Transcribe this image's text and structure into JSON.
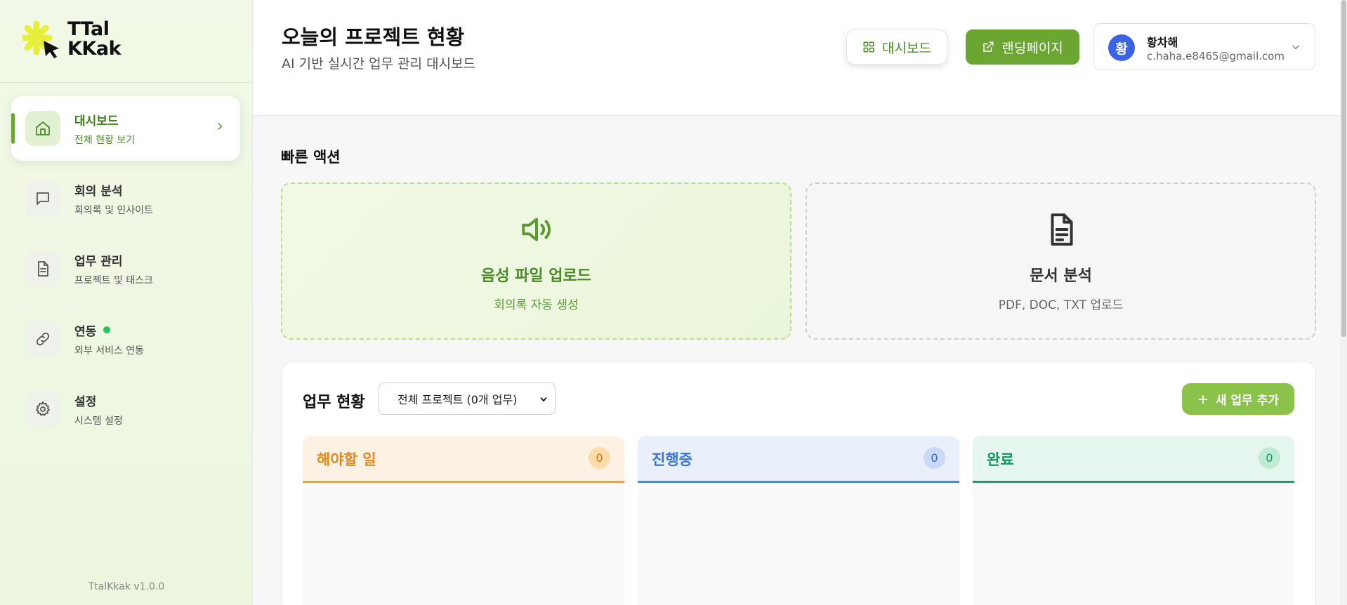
{
  "app": {
    "logo_line1": "TTal",
    "logo_line2": "KKak",
    "version": "TtalKkak v1.0.0"
  },
  "sidebar": {
    "items": [
      {
        "title": "대시보드",
        "subtitle": "전체 현황 보기",
        "icon": "home-icon",
        "active": true
      },
      {
        "title": "회의 분석",
        "subtitle": "회의록 및 인사이트",
        "icon": "message-icon"
      },
      {
        "title": "업무 관리",
        "subtitle": "프로젝트 및 태스크",
        "icon": "document-icon"
      },
      {
        "title": "연동",
        "subtitle": "외부 서비스 연동",
        "icon": "link-icon",
        "status": "connected"
      },
      {
        "title": "설정",
        "subtitle": "시스템 설정",
        "icon": "gear-icon"
      }
    ]
  },
  "header": {
    "title": "오늘의 프로젝트 현황",
    "subtitle": "AI 기반 실시간 업무 관리 대시보드",
    "dashboard_button": "대시보드",
    "landing_button": "랜딩페이지",
    "user": {
      "initial": "황",
      "name": "황차해",
      "email": "c.haha.e8465@gmail.com"
    }
  },
  "quick_actions": {
    "title": "빠른 액션",
    "items": [
      {
        "title": "음성 파일 업로드",
        "subtitle": "회의록 자동 생성",
        "icon": "speaker-icon"
      },
      {
        "title": "문서 분석",
        "subtitle": "PDF, DOC, TXT 업로드",
        "icon": "file-text-icon"
      }
    ]
  },
  "tasks": {
    "title": "업무 현황",
    "project_select": "전체 프로젝트 (0개 업무)",
    "add_button": "새 업무 추가",
    "columns": [
      {
        "title": "해야할 일",
        "count": "0",
        "color": "#f5a623"
      },
      {
        "title": "진행중",
        "count": "0",
        "color": "#4a86e8"
      },
      {
        "title": "완료",
        "count": "0",
        "color": "#16a36b"
      }
    ]
  },
  "colors": {
    "brand": "#6aa631",
    "brand_light": "#8bc34a",
    "logo_accent": "#e8ef3a"
  }
}
